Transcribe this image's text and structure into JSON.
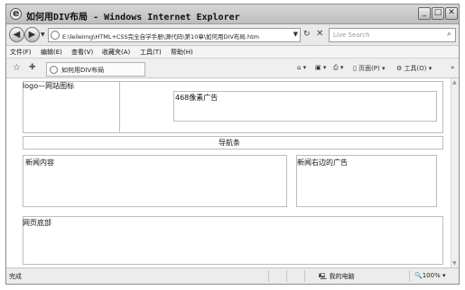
{
  "window": {
    "title": "如何用DIV布局 - Windows Internet Explorer"
  },
  "navbar": {
    "address": "E:\\leileimg\\HTML+CSS完全自学手册\\源代码\\第10章\\如何用DIV布局.htm",
    "search_placeholder": "Live Search"
  },
  "menu": [
    "文件(F)",
    "编辑(E)",
    "查看(V)",
    "收藏夹(A)",
    "工具(T)",
    "帮助(H)"
  ],
  "favbar": {
    "tab_title": "如何用DIV布局",
    "page_label": "页面(P)",
    "tools_label": "工具(O)"
  },
  "content": {
    "logo": "logo—网站图标",
    "banner": "468像素广告",
    "nav": "导航条",
    "news": "新闻内容",
    "news_ad": "新闻右边的广告",
    "footer": "网页底部"
  },
  "status": {
    "text": "完成",
    "zone": "我的电脑",
    "zoom": "100%"
  },
  "icons": [
    "ie-icon",
    "back-icon",
    "forward-icon",
    "refresh-icon",
    "stop-icon",
    "search-icon",
    "star-icon",
    "home-icon",
    "feeds-icon",
    "print-icon",
    "computer-icon",
    "zoom-icon"
  ]
}
